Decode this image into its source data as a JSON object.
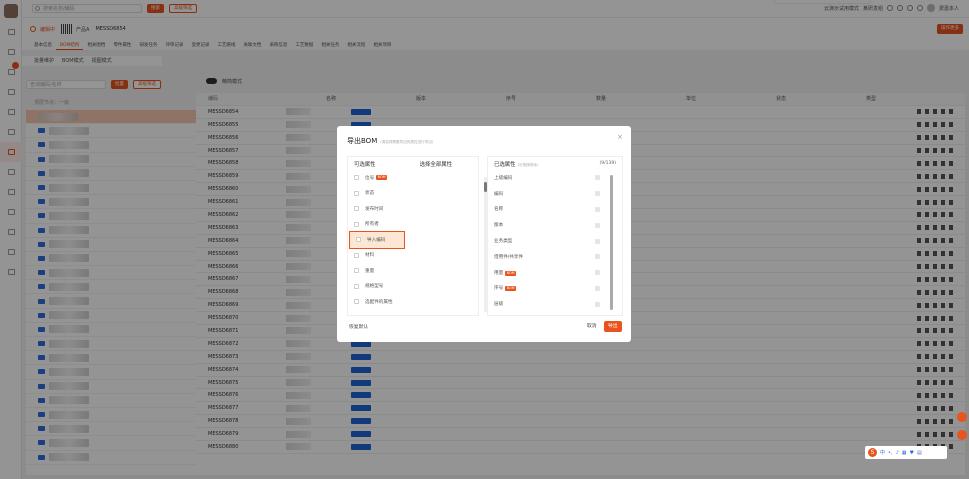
{
  "colors": {
    "accent": "#e8541e",
    "blue": "#2f6bdc"
  },
  "topbar": {
    "search_placeholder": "搜索名称/编码",
    "search_btn": "搜索",
    "adv_btn": "高级筛选",
    "right_text": "云演示试用模式",
    "right_org": "某研发组",
    "user": "费嘉本人"
  },
  "header": {
    "status": "编辑中",
    "title": "产品A",
    "number": "MESSD6854",
    "more_btn": "操作更多"
  },
  "tabs": [
    "基本信息",
    "BOM结构",
    "相关图档",
    "零件属性",
    "研发任务",
    "评审记录",
    "变更记录",
    "工艺路线",
    "关联文档",
    "采购信息",
    "工艺数据",
    "相关任务",
    "相关流程",
    "相关项目"
  ],
  "subtabs": [
    "批量维护",
    "BOM模式",
    "视图模式"
  ],
  "toolbar": {
    "input_placeholder": "查询编码/名称",
    "btn1": "批量",
    "btn2": "高级筛选"
  },
  "tree_label": "顶层节点：一级",
  "grid": {
    "toggle_label": "精简模式",
    "head": [
      "编码",
      "名称",
      "版本",
      "序号",
      "数量",
      "单位",
      "状态",
      "类型"
    ],
    "codes": [
      "MESSD6854",
      "MESSD6855",
      "MESSD6856",
      "MESSD6857",
      "MESSD6858",
      "MESSD6859",
      "MESSD6860",
      "MESSD6861",
      "MESSD6862",
      "MESSD6863",
      "MESSD6864",
      "MESSD6865",
      "MESSD6866",
      "MESSD6867",
      "MESSD6868",
      "MESSD6869",
      "MESSD6870",
      "MESSD6871",
      "MESSD6872",
      "MESSD6873",
      "MESSD6874",
      "MESSD6875",
      "MESSD6876",
      "MESSD6877",
      "MESSD6878",
      "MESSD6879",
      "MESSD6880"
    ]
  },
  "modal": {
    "title": "导出BOM",
    "subtitle": "(请选择需要导出的属性进行导出)",
    "left_header": "可选属性",
    "select_all": "选择全部属性",
    "left_items": [
      {
        "label": "位号",
        "tag": "BOM"
      },
      {
        "label": "状态",
        "tag": ""
      },
      {
        "label": "发布时间",
        "tag": ""
      },
      {
        "label": "所有者",
        "tag": ""
      },
      {
        "label": "导入编码",
        "tag": "",
        "highlight": true
      },
      {
        "label": "材料",
        "tag": ""
      },
      {
        "label": "重量",
        "tag": ""
      },
      {
        "label": "规格型号",
        "tag": ""
      },
      {
        "label": "选配件的属性",
        "tag": ""
      }
    ],
    "right_header": "已选属性",
    "right_hint": "(可拖拽排序)",
    "right_count": "(9/139)",
    "right_items": [
      {
        "label": "上级编码",
        "tag": ""
      },
      {
        "label": "编码",
        "tag": ""
      },
      {
        "label": "名称",
        "tag": ""
      },
      {
        "label": "版本",
        "tag": ""
      },
      {
        "label": "业务类型",
        "tag": ""
      },
      {
        "label": "借用件/共享件",
        "tag": ""
      },
      {
        "label": "用量",
        "tag": "BOM"
      },
      {
        "label": "序号",
        "tag": "BOM"
      },
      {
        "label": "层级",
        "tag": ""
      }
    ],
    "reset_btn": "恢复默认",
    "cancel_btn": "取消",
    "ok_btn": "导出"
  },
  "tray": {
    "lang": "中"
  }
}
